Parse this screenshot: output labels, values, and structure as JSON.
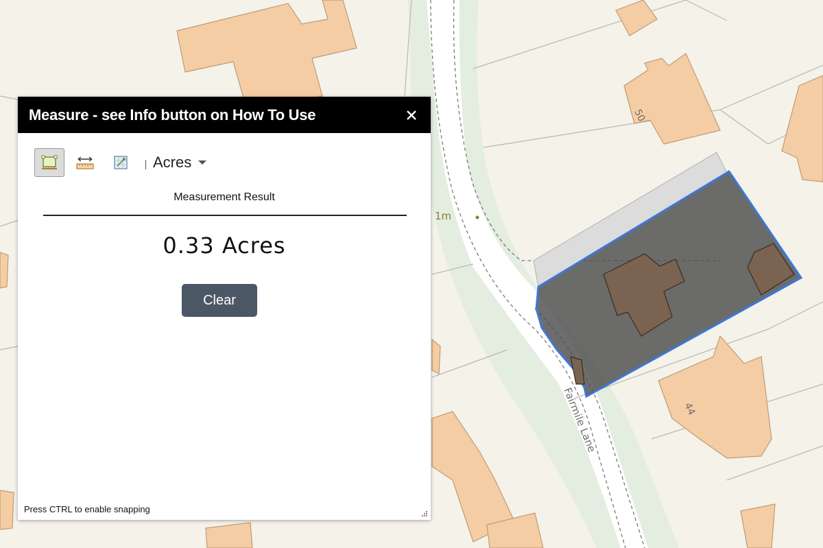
{
  "widget": {
    "title": "Measure - see Info button on How To Use",
    "close_icon": "close-icon",
    "tools": [
      {
        "icon": "area-measure-icon",
        "active": true
      },
      {
        "icon": "distance-measure-icon",
        "active": false
      },
      {
        "icon": "location-measure-icon",
        "active": false
      }
    ],
    "unit_selected": "Acres",
    "result_heading": "Measurement Result",
    "result_value": "0.33 Acres",
    "clear_label": "Clear",
    "snap_hint": "Press CTRL to enable snapping"
  },
  "map": {
    "road_label": "Fairmile Lane",
    "house_numbers": [
      "50",
      "44"
    ],
    "spot_label": "1m",
    "colors": {
      "background": "#f4f2e9",
      "building": "#f5cda5",
      "building_outline": "#c09a72",
      "verge": "#e4eee0",
      "selection_fill": "#4d4d4d",
      "selection_outline": "#3c78d8"
    }
  }
}
